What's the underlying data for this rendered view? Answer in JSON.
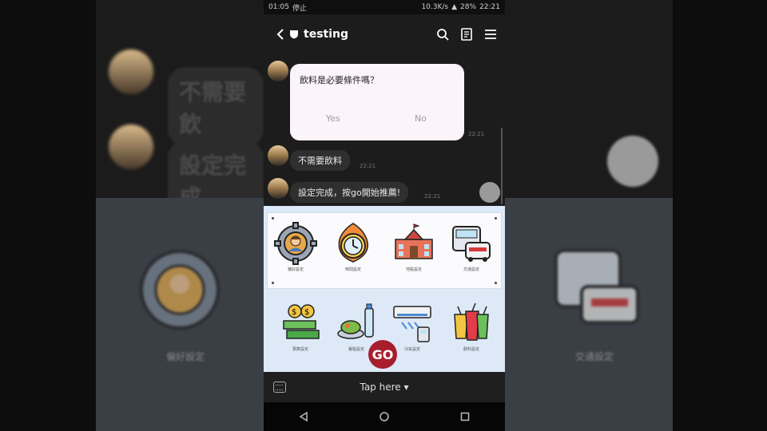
{
  "status_bar": {
    "time": "01:05",
    "muted_label": "停止",
    "network_speed": "10.3K/s",
    "battery": "28%",
    "clock_right": "22:21"
  },
  "header": {
    "title": "testing",
    "back_icon": "chevron-left-icon",
    "icons": [
      "search-icon",
      "notes-icon",
      "menu-icon"
    ]
  },
  "chat": {
    "question_card": {
      "question": "飲料是必要條件嗎？",
      "yes_label": "Yes",
      "no_label": "No",
      "time": "22:21"
    },
    "messages": [
      {
        "text": "不需要飲料",
        "time": "22:21"
      },
      {
        "text": "設定完成，按go開始推薦!",
        "time": "22:21"
      }
    ]
  },
  "rich_menu": {
    "items": [
      {
        "label": "偏好設定",
        "icon": "user-gear-icon"
      },
      {
        "label": "時間設定",
        "icon": "clock-icon"
      },
      {
        "label": "地點設定",
        "icon": "school-building-icon"
      },
      {
        "label": "交通設定",
        "icon": "bus-car-icon"
      },
      {
        "label": "預算設定",
        "icon": "money-icon"
      },
      {
        "label": "餐點設定",
        "icon": "food-drink-icon"
      },
      {
        "label": "冷氣設定",
        "icon": "air-conditioner-icon"
      },
      {
        "label": "飲料設定",
        "icon": "drinks-icon"
      }
    ],
    "go_label": "GO"
  },
  "bottom_bar": {
    "tap_here": "Tap here ▾",
    "keyboard_icon": "keyboard-icon"
  },
  "background": {
    "blurred_msg_1": "不需要飲",
    "blurred_msg_2": "設定完成",
    "left_label": "偏好設定",
    "right_label": "交通設定"
  },
  "colors": {
    "go_button": "#a81e2c",
    "rich_menu_bg": "#dde9f7",
    "card_bg": "#fbf4fa"
  }
}
